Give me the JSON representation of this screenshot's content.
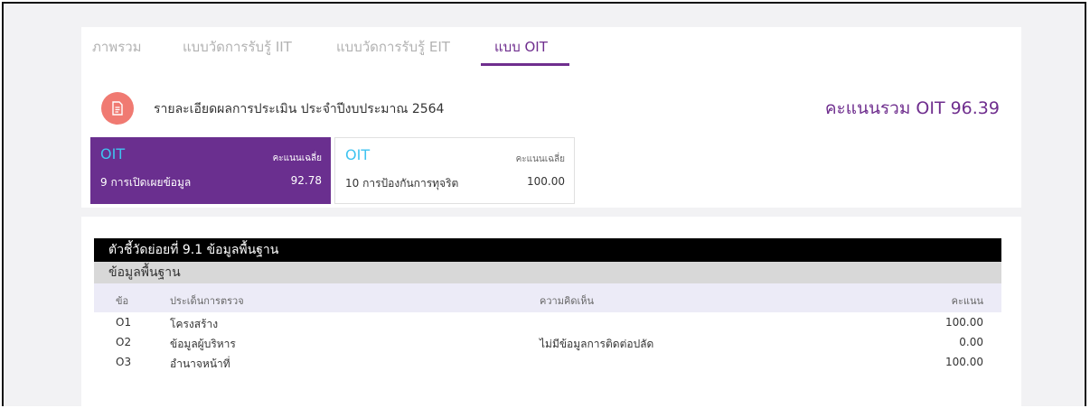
{
  "tabs": [
    {
      "label": "ภาพรวม"
    },
    {
      "label": "แบบวัดการรับรู้ IIT"
    },
    {
      "label": "แบบวัดการรับรู้ EIT"
    },
    {
      "label": "แบบ OIT"
    }
  ],
  "header": {
    "icon": "document-icon",
    "title": "รายละเอียดผลการประเมิน ประจำปีงบประมาณ 2564",
    "total_label": "คะแนนรวม OIT 96.39"
  },
  "indicators": [
    {
      "code": "OIT",
      "avg_label": "คะแนนเฉลี่ย",
      "name": "9 การเปิดเผยข้อมูล",
      "score": "92.78"
    },
    {
      "code": "OIT",
      "avg_label": "คะแนนเฉลี่ย",
      "name": "10 การป้องกันการทุจริต",
      "score": "100.00"
    }
  ],
  "table": {
    "section_title": "ตัวชี้วัดย่อยที่ 9.1 ข้อมูลพื้นฐาน",
    "group_title": "ข้อมูลพื้นฐาน",
    "columns": [
      "ข้อ",
      "ประเด็นการตรวจ",
      "ความคิดเห็น",
      "คะแนน"
    ],
    "rows": [
      {
        "no": "O1",
        "item": "โครงสร้าง",
        "comment": "",
        "score": "100.00"
      },
      {
        "no": "O2",
        "item": "ข้อมูลผู้บริหาร",
        "comment": "ไม่มีข้อมูลการติดต่อปลัด",
        "score": "0.00"
      },
      {
        "no": "O3",
        "item": "อำนาจหน้าที่",
        "comment": "",
        "score": "100.00"
      }
    ]
  },
  "colors": {
    "accent": "#6f2e8e",
    "active_box": "#6a2f8f",
    "oit_label": "#3fc3f0",
    "icon_bg": "#f07a72"
  }
}
